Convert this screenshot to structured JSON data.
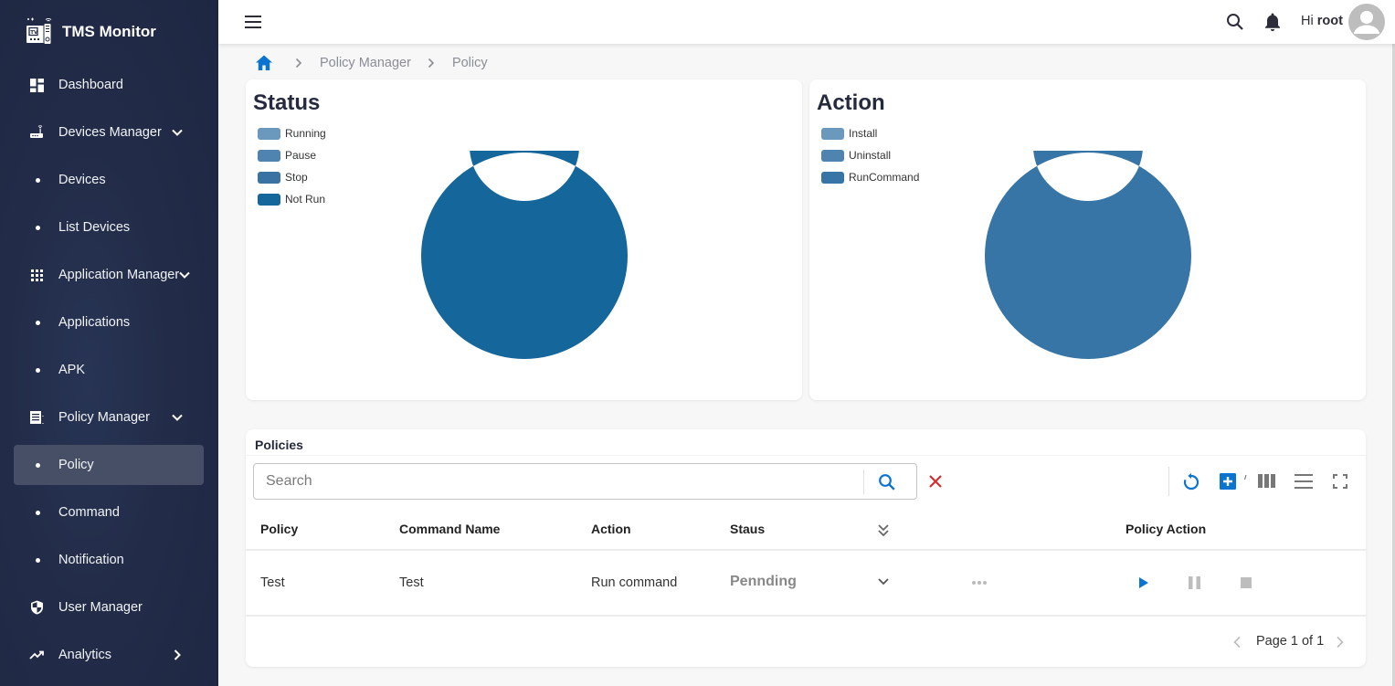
{
  "app": {
    "title": "TMS Monitor"
  },
  "sidebar": {
    "items": [
      {
        "label": "Dashboard",
        "icon": "dashboard-icon",
        "type": "top"
      },
      {
        "label": "Devices Manager",
        "icon": "router-icon",
        "type": "group",
        "expanded": true
      },
      {
        "label": "Devices",
        "type": "sub"
      },
      {
        "label": "List Devices",
        "type": "sub"
      },
      {
        "label": "Application Manager",
        "icon": "apps-grid-icon",
        "type": "group",
        "expanded": true
      },
      {
        "label": "Applications",
        "type": "sub"
      },
      {
        "label": "APK",
        "type": "sub"
      },
      {
        "label": "Policy Manager",
        "icon": "list-alt-icon",
        "type": "group",
        "expanded": true
      },
      {
        "label": "Policy",
        "type": "sub",
        "active": true
      },
      {
        "label": "Command",
        "type": "sub"
      },
      {
        "label": "Notification",
        "type": "sub"
      },
      {
        "label": "User Manager",
        "icon": "shield-icon",
        "type": "top"
      },
      {
        "label": "Analytics",
        "icon": "trending-up-icon",
        "type": "group",
        "expanded": false
      }
    ]
  },
  "header": {
    "greeting_prefix": "Hi",
    "username": "root"
  },
  "breadcrumb": {
    "items": [
      "Policy Manager",
      "Policy"
    ]
  },
  "chart_data": [
    {
      "type": "pie",
      "title": "Status",
      "legend": "top-left",
      "categories": [
        "Running",
        "Pause",
        "Stop",
        "Not Run"
      ],
      "values": [
        0,
        0,
        0,
        1
      ],
      "colors": [
        "#6b98bd",
        "#4f84b0",
        "#3a72a4",
        "#15669b"
      ],
      "donut": true
    },
    {
      "type": "pie",
      "title": "Action",
      "legend": "top-left",
      "categories": [
        "Install",
        "Uninstall",
        "RunCommand"
      ],
      "values": [
        0,
        0,
        1
      ],
      "colors": [
        "#6b98bd",
        "#4f84b0",
        "#3675a5"
      ],
      "donut": true
    }
  ],
  "policies": {
    "title": "Policies",
    "search": {
      "placeholder": "Search",
      "value": ""
    },
    "columns": [
      "Policy",
      "Command Name",
      "Action",
      "Staus",
      "Policy Action"
    ],
    "rows": [
      {
        "policy": "Test",
        "command_name": "Test",
        "action": "Run command",
        "status": "Pennding"
      }
    ],
    "pagination": {
      "label": "Page 1 of 1",
      "current": 1,
      "total": 1
    }
  },
  "colors": {
    "sidebar_bg": "#222b46",
    "accent": "#0a74d0",
    "danger": "#d32f2f",
    "active_item": "#464f65"
  }
}
